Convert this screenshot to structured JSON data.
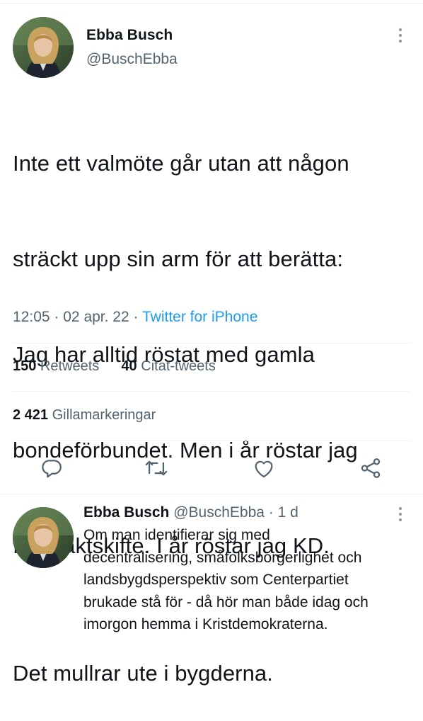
{
  "tweet": {
    "author_name": "Ebba Busch",
    "author_handle": "@BuschEbba",
    "text_lines": [
      "Inte ett valmöte går utan att någon",
      "sträckt upp sin arm för att berätta:",
      "Jag har alltid röstat med gamla",
      "bondeförbundet. Men i år röstar jag",
      "för maktskifte. I år röstar jag KD."
    ],
    "text_last_paragraph": "Det mullrar ute i bygderna.",
    "time": "12:05",
    "date": "02 apr. 22",
    "separator": "·",
    "source": "Twitter for iPhone"
  },
  "stats": {
    "retweets_count": "150",
    "retweets_label": "Retweets",
    "quotes_count": "40",
    "quotes_label": "Citat-tweets",
    "likes_count": "2 421",
    "likes_label": "Gillamarkeringar"
  },
  "actions": [
    {
      "icon": "reply-icon"
    },
    {
      "icon": "retweet-icon"
    },
    {
      "icon": "like-icon"
    },
    {
      "icon": "share-icon"
    }
  ],
  "reply": {
    "author_name": "Ebba Busch",
    "author_handle": "@BuschEbba",
    "separator": "·",
    "age": "1 d",
    "text_lines": [
      "Om man identifierar sig med",
      "decentralisering, småfolksborgerlighet och",
      "landsbygdsperspektiv som Centerpartiet",
      "brukade stå för - då hör man både idag och",
      "imorgon hemma i Kristdemokraterna."
    ]
  },
  "colors": {
    "text": "#0f1419",
    "secondary": "#536471",
    "link": "#1d9bf0",
    "divider": "#eff3f4",
    "icon": "#536471"
  }
}
